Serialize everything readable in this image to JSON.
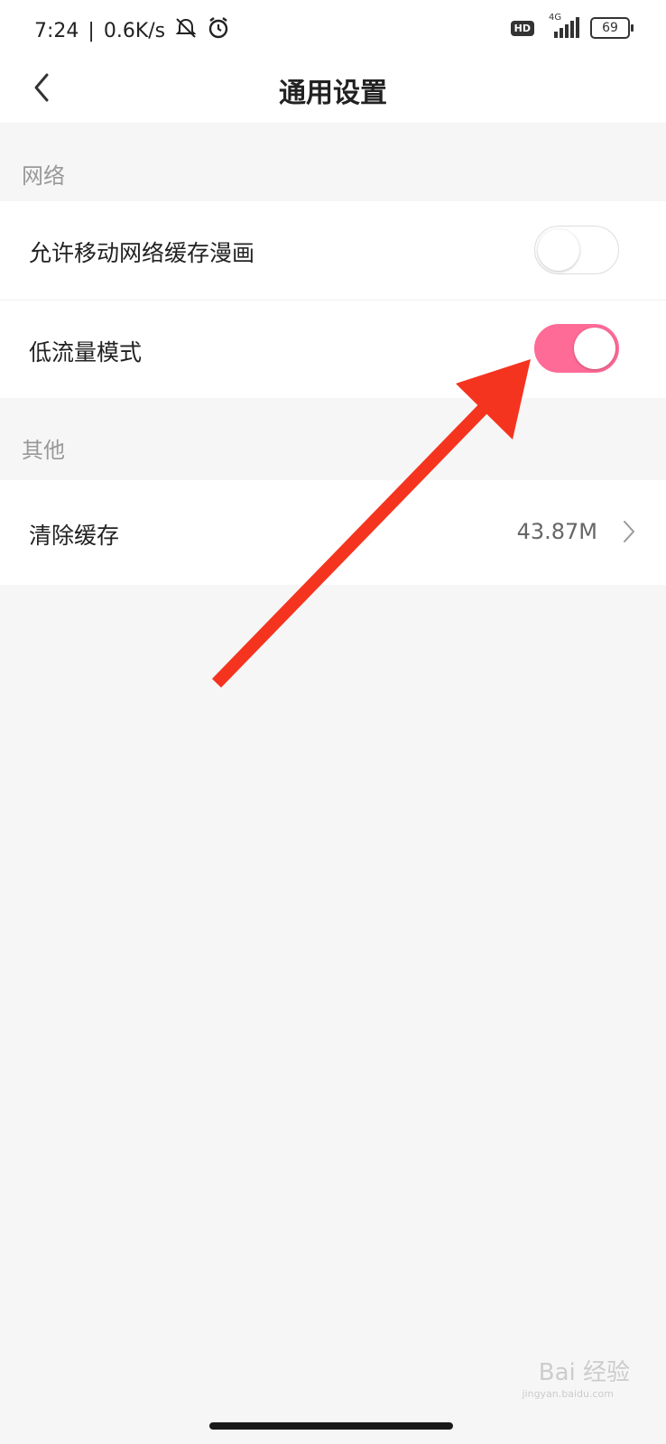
{
  "status_bar": {
    "time": "7:24",
    "speed": "0.6K/s",
    "hd_badge": "HD",
    "network_type": "4G",
    "battery": "69",
    "icons": [
      "mute-icon",
      "alarm-icon",
      "signal-icon",
      "battery-icon"
    ]
  },
  "header": {
    "title": "通用设置",
    "back_icon": "back-chevron-icon"
  },
  "sections": {
    "network": {
      "title": "网络",
      "items": [
        {
          "label": "允许移动网络缓存漫画",
          "toggle": "off"
        },
        {
          "label": "低流量模式",
          "toggle": "on"
        }
      ]
    },
    "other": {
      "title": "其他",
      "items": [
        {
          "label": "清除缓存",
          "value": "43.87M"
        }
      ]
    }
  },
  "watermark": {
    "text": "Bai 经验",
    "sub": "jingyan.baidu.com"
  },
  "colors": {
    "accent": "#ff6b97",
    "annotation_arrow": "#f5341f",
    "background": "#f6f6f6"
  }
}
